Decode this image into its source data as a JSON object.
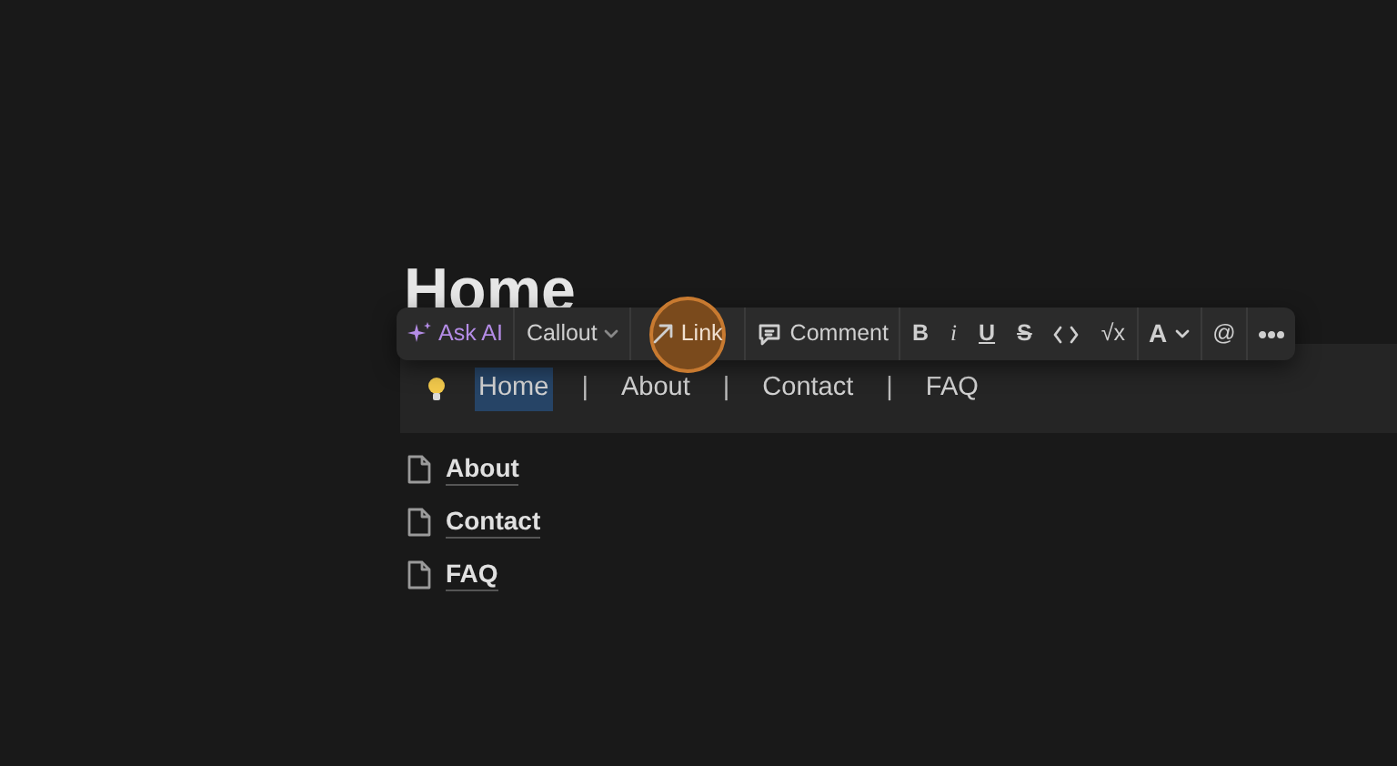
{
  "page": {
    "title": "Home"
  },
  "toolbar": {
    "ask_ai": "Ask AI",
    "block_type": "Callout",
    "link": {
      "label": "Link",
      "highlighted": true
    },
    "comment": "Comment",
    "formats": [
      {
        "label": "B",
        "kind": "bold"
      },
      {
        "label": "i",
        "kind": "italic"
      },
      {
        "label": "U",
        "kind": "underline"
      },
      {
        "label": "S",
        "kind": "strike"
      },
      {
        "kind": "code"
      },
      {
        "label": "√x",
        "kind": "math"
      }
    ],
    "text_color_label": "A",
    "mention": "@"
  },
  "callout": {
    "items": [
      {
        "text": "Home",
        "kind": "link",
        "selected": true
      },
      {
        "text": "|",
        "kind": "separator"
      },
      {
        "text": "About",
        "kind": "link",
        "selected": false
      },
      {
        "text": "|",
        "kind": "separator"
      },
      {
        "text": "Contact",
        "kind": "link",
        "selected": false
      },
      {
        "text": "|",
        "kind": "separator"
      },
      {
        "text": "FAQ",
        "kind": "link",
        "selected": false
      }
    ]
  },
  "pages": [
    {
      "title": "About"
    },
    {
      "title": "Contact"
    },
    {
      "title": "FAQ"
    }
  ]
}
